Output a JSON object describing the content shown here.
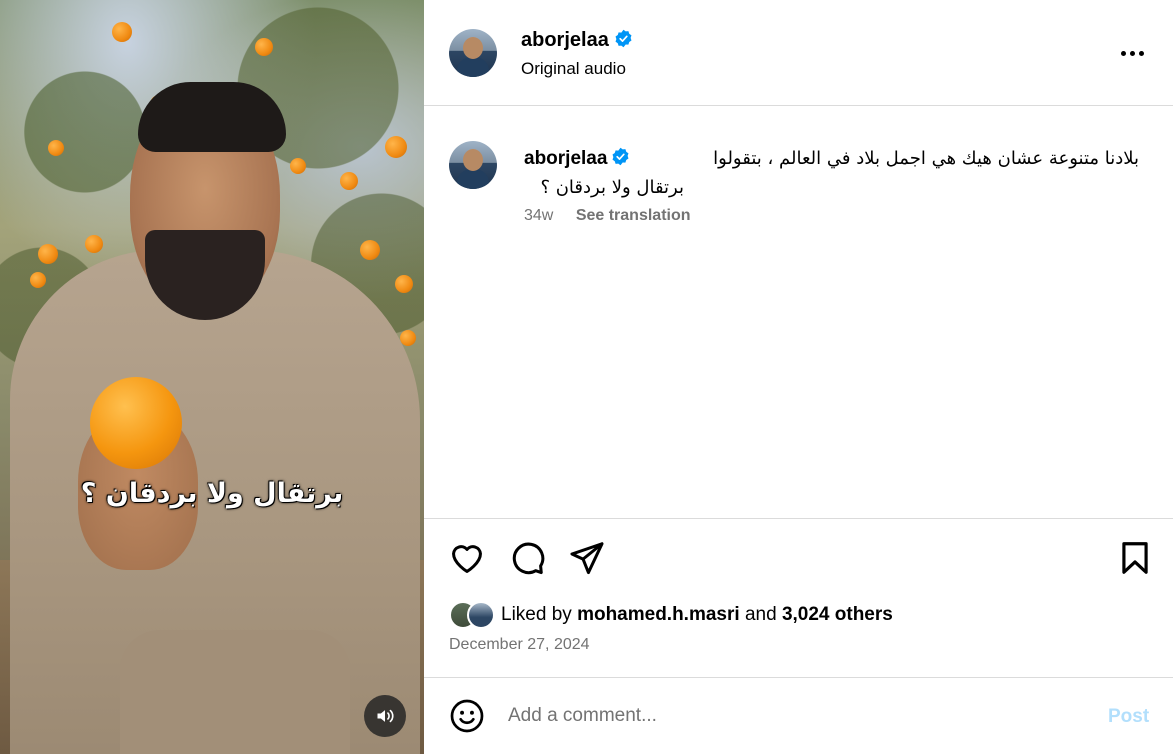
{
  "media": {
    "subtitle": "برتقال ولا بردقان ؟",
    "audio_icon": "speaker-icon"
  },
  "header": {
    "username": "aborjelaa",
    "verified": true,
    "subtitle": "Original audio",
    "more_icon": "more-horizontal-icon"
  },
  "caption": {
    "username": "aborjelaa",
    "text_line1": "بلادنا متنوعة عشان هيك هي اجمل بلاد في العالم ، بتقولوا",
    "text_line2": "برتقال ولا بردقان ؟",
    "time": "34w",
    "see_translation": "See translation"
  },
  "actions": {
    "like_icon": "heart-icon",
    "comment_icon": "comment-icon",
    "share_icon": "paper-plane-icon",
    "save_icon": "bookmark-icon"
  },
  "likes": {
    "prefix": "Liked by",
    "user": "mohamed.h.masri",
    "and": "and",
    "others": "3,024 others"
  },
  "date": "December 27, 2024",
  "comment": {
    "placeholder": "Add a comment...",
    "post_label": "Post"
  },
  "colors": {
    "verified_blue": "#0095f6",
    "post_disabled": "#b2dffc",
    "secondary_text": "#737373",
    "divider": "#dbdbdb"
  }
}
